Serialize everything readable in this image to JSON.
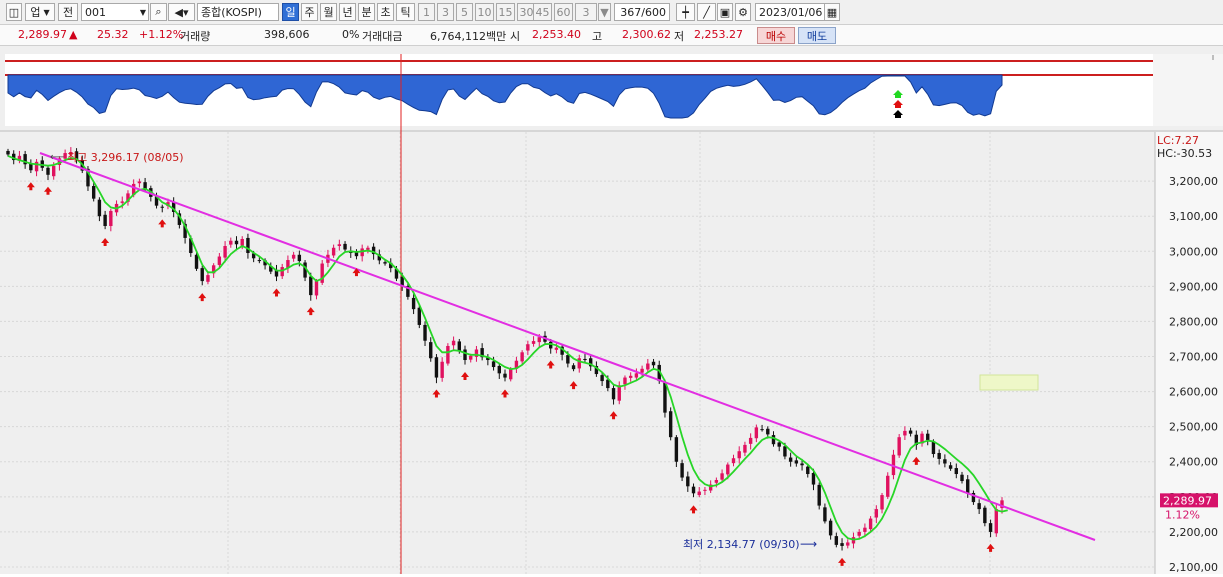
{
  "toolbar": {
    "market": "업",
    "prefix": "전",
    "code": "001",
    "name": "종합(KOSPI)",
    "periods": [
      "일",
      "주",
      "월",
      "년",
      "분",
      "초",
      "틱"
    ],
    "active_period": "일",
    "intervals": [
      "1",
      "3",
      "5",
      "10",
      "15",
      "30",
      "45",
      "60"
    ],
    "interval_value": "3",
    "count": "367/600",
    "date": "2023/01/06"
  },
  "quote": {
    "price": "2,289.97",
    "change": "25.32",
    "change_pct": "+1.12%",
    "volume_label": "거래량",
    "volume": "398,606",
    "volume_pct": "0%",
    "amount_label": "거래대금",
    "amount": "6,764,112백만",
    "open_label": "시",
    "open": "2,253.40",
    "high_label": "고",
    "high": "2,300.62",
    "low_label": "저",
    "low": "2,253.27",
    "buy_label": "매수",
    "sell_label": "매도"
  },
  "chart_data": {
    "type": "candlestick",
    "yticks": [
      "3,200,00",
      "3,100,00",
      "3,000,00",
      "2,900,00",
      "2,800,00",
      "2,700,00",
      "2,600,00",
      "2,500,00",
      "2,400,00",
      "2,300,00",
      "2,200,00",
      "2,100,00"
    ],
    "ytick_values": [
      3200,
      3100,
      3000,
      2900,
      2800,
      2700,
      2600,
      2500,
      2400,
      2300,
      2200,
      2100
    ],
    "ylim": [
      2080,
      3340
    ],
    "lc_label": "LC:7.27",
    "hc_label": "HC:-30.53",
    "last_price_label": "2,289.97",
    "last_pct_label": "1.12%",
    "high_annotation": "최고 3,296.17 (08/05)",
    "low_annotation": "최저 2,134.77 (09/30)",
    "close_series": [
      3276,
      3260,
      3272,
      3248,
      3231,
      3255,
      3238,
      3218,
      3243,
      3265,
      3280,
      3283,
      3262,
      3230,
      3185,
      3150,
      3100,
      3072,
      3115,
      3135,
      3142,
      3165,
      3192,
      3199,
      3175,
      3155,
      3130,
      3125,
      3140,
      3112,
      3075,
      3038,
      2995,
      2950,
      2915,
      2932,
      2960,
      2985,
      3015,
      3030,
      3020,
      3035,
      2995,
      2980,
      2972,
      2960,
      2942,
      2928,
      2955,
      2975,
      2990,
      2972,
      2925,
      2875,
      2915,
      2965,
      2990,
      3010,
      3020,
      3005,
      2995,
      2986,
      3008,
      3010,
      2992,
      2974,
      2965,
      2952,
      2922,
      2900,
      2870,
      2835,
      2790,
      2745,
      2695,
      2640,
      2685,
      2730,
      2745,
      2715,
      2690,
      2702,
      2720,
      2698,
      2690,
      2670,
      2652,
      2640,
      2663,
      2688,
      2712,
      2735,
      2744,
      2755,
      2742,
      2723,
      2725,
      2705,
      2680,
      2664,
      2695,
      2690,
      2672,
      2650,
      2630,
      2610,
      2578,
      2618,
      2640,
      2645,
      2652,
      2665,
      2680,
      2675,
      2630,
      2540,
      2470,
      2400,
      2355,
      2330,
      2310,
      2315,
      2320,
      2335,
      2348,
      2367,
      2392,
      2410,
      2430,
      2448,
      2468,
      2498,
      2492,
      2478,
      2450,
      2443,
      2415,
      2400,
      2395,
      2390,
      2365,
      2335,
      2275,
      2230,
      2190,
      2163,
      2160,
      2170,
      2185,
      2200,
      2212,
      2238,
      2265,
      2305,
      2360,
      2420,
      2470,
      2488,
      2480,
      2448,
      2480,
      2462,
      2422,
      2408,
      2395,
      2380,
      2365,
      2345,
      2310,
      2285,
      2265,
      2225,
      2200,
      2265,
      2289.97
    ],
    "ma_series": [
      3272,
      3265,
      3260,
      3255,
      3250,
      3248,
      3246,
      3244,
      3246,
      3252,
      3260,
      3266,
      3263,
      3248,
      3225,
      3198,
      3170,
      3140,
      3125,
      3122,
      3130,
      3145,
      3162,
      3175,
      3178,
      3170,
      3156,
      3140,
      3132,
      3120,
      3100,
      3072,
      3038,
      3000,
      2962,
      2940,
      2940,
      2952,
      2972,
      2992,
      3005,
      3015,
      3008,
      2996,
      2985,
      2972,
      2958,
      2945,
      2945,
      2952,
      2962,
      2966,
      2955,
      2930,
      2915,
      2922,
      2940,
      2962,
      2985,
      2998,
      3000,
      2998,
      3000,
      3002,
      2998,
      2988,
      2976,
      2966,
      2950,
      2932,
      2910,
      2882,
      2848,
      2810,
      2770,
      2730,
      2712,
      2712,
      2718,
      2716,
      2710,
      2705,
      2705,
      2702,
      2698,
      2690,
      2680,
      2670,
      2664,
      2666,
      2676,
      2692,
      2710,
      2726,
      2735,
      2736,
      2732,
      2722,
      2708,
      2694,
      2686,
      2682,
      2678,
      2668,
      2655,
      2638,
      2620,
      2614,
      2618,
      2625,
      2632,
      2642,
      2655,
      2665,
      2660,
      2630,
      2585,
      2530,
      2472,
      2420,
      2378,
      2350,
      2336,
      2330,
      2333,
      2342,
      2355,
      2372,
      2390,
      2408,
      2425,
      2445,
      2462,
      2470,
      2468,
      2460,
      2448,
      2432,
      2416,
      2405,
      2392,
      2375,
      2348,
      2312,
      2270,
      2228,
      2198,
      2182,
      2178,
      2180,
      2188,
      2200,
      2215,
      2238,
      2270,
      2310,
      2358,
      2405,
      2438,
      2452,
      2455,
      2460,
      2458,
      2448,
      2436,
      2422,
      2408,
      2395,
      2380,
      2362,
      2338,
      2312,
      2285,
      2262,
      2258,
      2262
    ]
  }
}
